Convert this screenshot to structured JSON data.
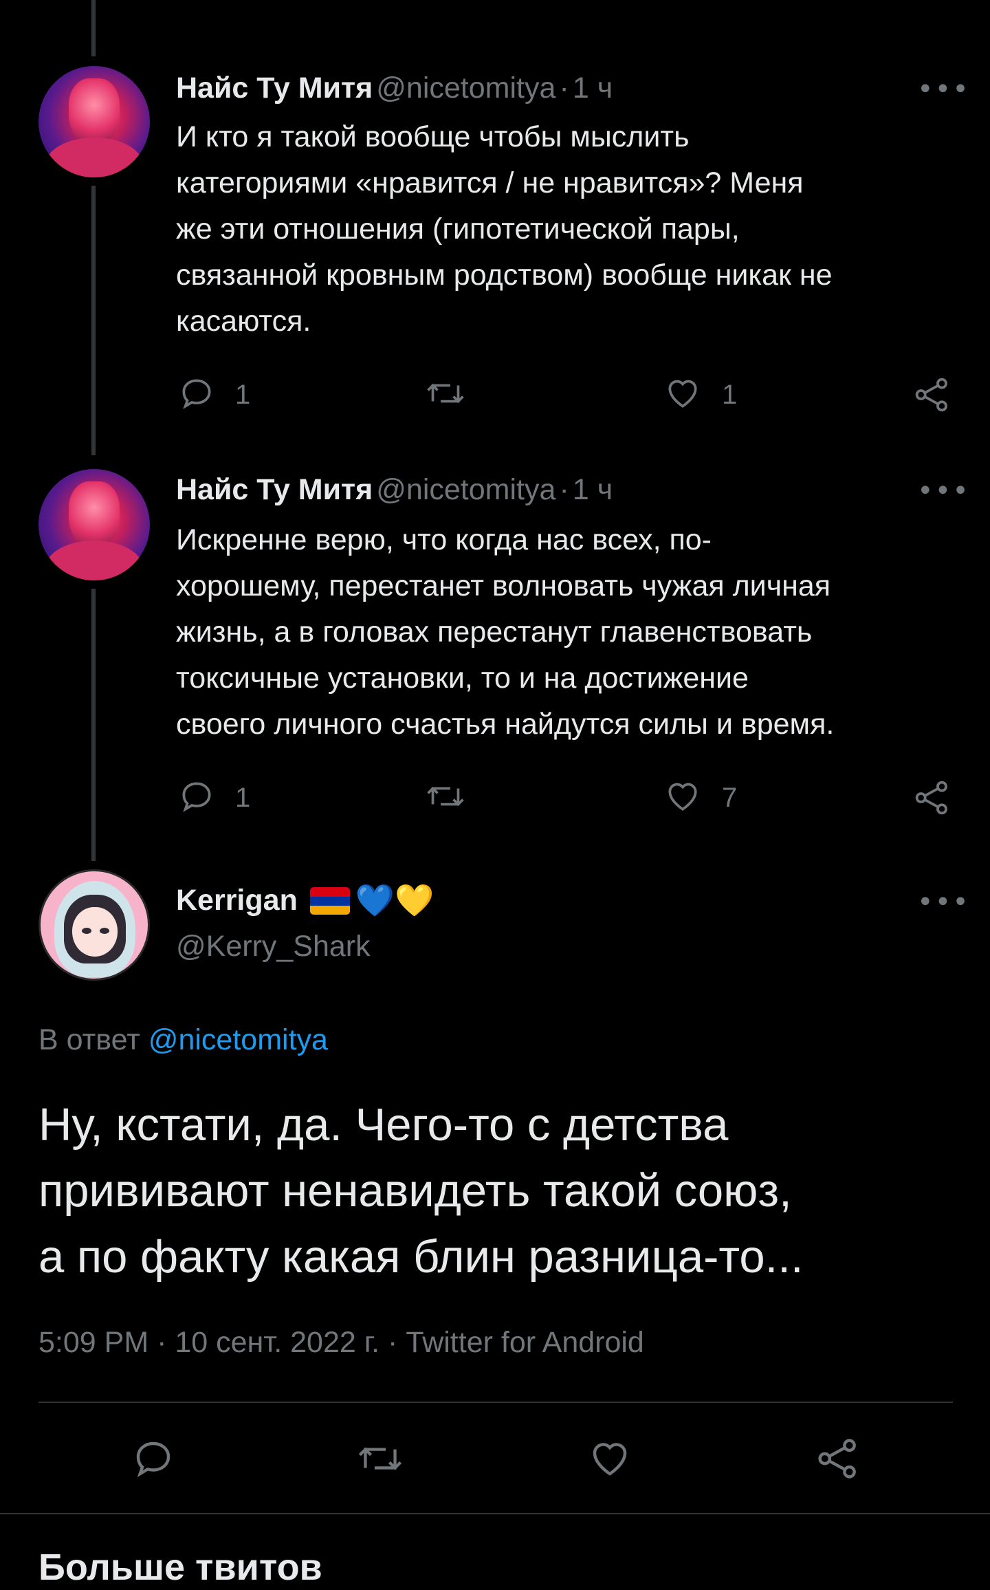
{
  "tweets": [
    {
      "author": "Найс Ту Митя",
      "handle": "@nicetomitya",
      "separator": "·",
      "time": "1 ч",
      "text": "И кто я такой вообще чтобы мыслить\nкатегориями «нравится / не нравится»? Меня\nже эти отношения (гипотетической пары,\nсвязанной кровным родством) вообще никак не\nкасаются.",
      "reply_count": "1",
      "like_count": "1"
    },
    {
      "author": "Найс Ту Митя",
      "handle": "@nicetomitya",
      "separator": "·",
      "time": "1 ч",
      "text": "Искренне верю, что когда нас всех, по-\nхорошему, перестанет волновать чужая личная\nжизнь, а в головах перестанут главенствовать\nтоксичные установки, то и на достижение\nсвоего личного счастья найдутся силы и время.",
      "reply_count": "1",
      "like_count": "7"
    }
  ],
  "main_tweet": {
    "author": "Kerrigan",
    "emoji": "💙💛",
    "handle": "@Kerry_Shark",
    "reply_prefix": "В ответ",
    "reply_to": "@nicetomitya",
    "text": "Ну, кстати, да. Чего-то с детства\nпрививают ненавидеть такой союз,\nа по факту какая блин разница-то...",
    "meta": "5:09 PM · 10 сент. 2022 г. · Twitter for Android"
  },
  "section": {
    "more_tweets": "Больше твитов"
  },
  "icons": {
    "reply": "reply-icon",
    "retweet": "retweet-icon",
    "like": "heart-icon",
    "share": "share-icon",
    "more": "more-icon",
    "flag": "armenia-flag-icon"
  },
  "colors": {
    "background": "#000000",
    "text": "#e7e9ea",
    "muted": "#71767b",
    "link": "#1d9bf0",
    "divider": "#2f3336"
  },
  "more_symbol": "•••"
}
